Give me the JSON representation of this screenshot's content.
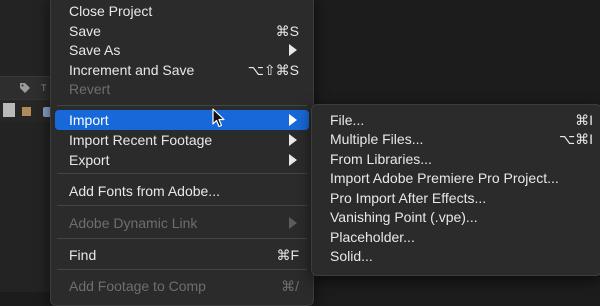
{
  "app_background": {
    "strip_text": "T"
  },
  "menu": {
    "items": [
      {
        "label": "Close Project",
        "shortcut": "",
        "submenu": false,
        "disabled": false
      },
      {
        "label": "Save",
        "shortcut": "⌘S",
        "submenu": false,
        "disabled": false
      },
      {
        "label": "Save As",
        "shortcut": "",
        "submenu": true,
        "disabled": false
      },
      {
        "label": "Increment and Save",
        "shortcut": "⌥⇧⌘S",
        "submenu": false,
        "disabled": false
      },
      {
        "label": "Revert",
        "shortcut": "",
        "submenu": false,
        "disabled": true
      },
      {
        "label": "Import",
        "shortcut": "",
        "submenu": true,
        "disabled": false,
        "highlighted": true
      },
      {
        "label": "Import Recent Footage",
        "shortcut": "",
        "submenu": true,
        "disabled": false
      },
      {
        "label": "Export",
        "shortcut": "",
        "submenu": true,
        "disabled": false
      },
      {
        "label": "Add Fonts from Adobe...",
        "shortcut": "",
        "submenu": false,
        "disabled": false
      },
      {
        "label": "Adobe Dynamic Link",
        "shortcut": "",
        "submenu": true,
        "disabled": true
      },
      {
        "label": "Find",
        "shortcut": "⌘F",
        "submenu": false,
        "disabled": false
      },
      {
        "label": "Add Footage to Comp",
        "shortcut": "⌘/",
        "submenu": false,
        "disabled": true
      }
    ]
  },
  "import_submenu": {
    "items": [
      {
        "label": "File...",
        "shortcut": "⌘I"
      },
      {
        "label": "Multiple Files...",
        "shortcut": "⌥⌘I"
      },
      {
        "label": "From Libraries...",
        "shortcut": ""
      },
      {
        "label": "Import Adobe Premiere Pro Project...",
        "shortcut": ""
      },
      {
        "label": "Pro Import After Effects...",
        "shortcut": ""
      },
      {
        "label": "Vanishing Point (.vpe)...",
        "shortcut": ""
      },
      {
        "label": "Placeholder...",
        "shortcut": ""
      },
      {
        "label": "Solid...",
        "shortcut": ""
      }
    ]
  },
  "colors": {
    "menu_bg": "#2b2b2b",
    "highlight": "#1769d9",
    "text": "#e8e8e8",
    "disabled_text": "#6e6e6e"
  }
}
